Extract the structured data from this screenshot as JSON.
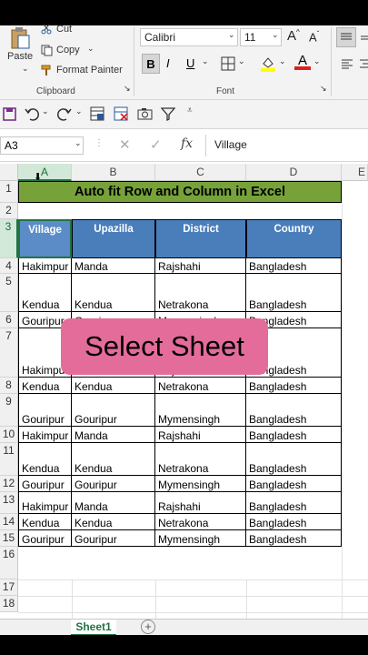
{
  "ribbon": {
    "clipboard": {
      "paste": "Paste",
      "cut": "Cut",
      "copy": "Copy",
      "format_painter": "Format Painter",
      "group_label": "Clipboard"
    },
    "font": {
      "font_name": "Calibri",
      "font_size": "11",
      "bold": "B",
      "italic": "I",
      "underline": "U",
      "grow": "A",
      "shrink": "A",
      "font_color": "A",
      "group_label": "Font"
    }
  },
  "formula_bar": {
    "name_box": "A3",
    "fx": "fx",
    "value": "Village"
  },
  "columns": [
    "A",
    "B",
    "C",
    "D",
    "E"
  ],
  "title": "Auto fit Row and Column in Excel",
  "headers": [
    "Village",
    "Upazilla",
    "District",
    "Country"
  ],
  "rows": [
    [
      "Hakimpur",
      "Manda",
      "Rajshahi",
      "Bangladesh"
    ],
    [
      "Kendua",
      "Kendua",
      "Netrakona",
      "Bangladesh"
    ],
    [
      "Gouripur",
      "Gouripur",
      "Mymensingh",
      "Bangladesh"
    ],
    [
      "Hakimpur",
      "Manda",
      "Rajshahi",
      "Bangladesh"
    ],
    [
      "Kendua",
      "Kendua",
      "Netrakona",
      "Bangladesh"
    ],
    [
      "Gouripur",
      "Gouripur",
      "Mymensingh",
      "Bangladesh"
    ],
    [
      "Hakimpur",
      "Manda",
      "Rajshahi",
      "Bangladesh"
    ],
    [
      "Kendua",
      "Kendua",
      "Netrakona",
      "Bangladesh"
    ],
    [
      "Gouripur",
      "Gouripur",
      "Mymensingh",
      "Bangladesh"
    ],
    [
      "Hakimpur",
      "Manda",
      "Rajshahi",
      "Bangladesh"
    ],
    [
      "Kendua",
      "Kendua",
      "Netrakona",
      "Bangladesh"
    ],
    [
      "Gouripur",
      "Gouripur",
      "Mymensingh",
      "Bangladesh"
    ]
  ],
  "row_numbers": [
    "1",
    "2",
    "3",
    "4",
    "5",
    "6",
    "7",
    "8",
    "9",
    "10",
    "11",
    "12",
    "13",
    "14",
    "15",
    "16",
    "17",
    "18"
  ],
  "sheet_tab": "Sheet1",
  "overlay_text": "Select Sheet",
  "colors": {
    "title_fill": "#77a23a",
    "header_fill": "#4a7ebb",
    "overlay": "#e36c9a",
    "accent": "#217346"
  }
}
